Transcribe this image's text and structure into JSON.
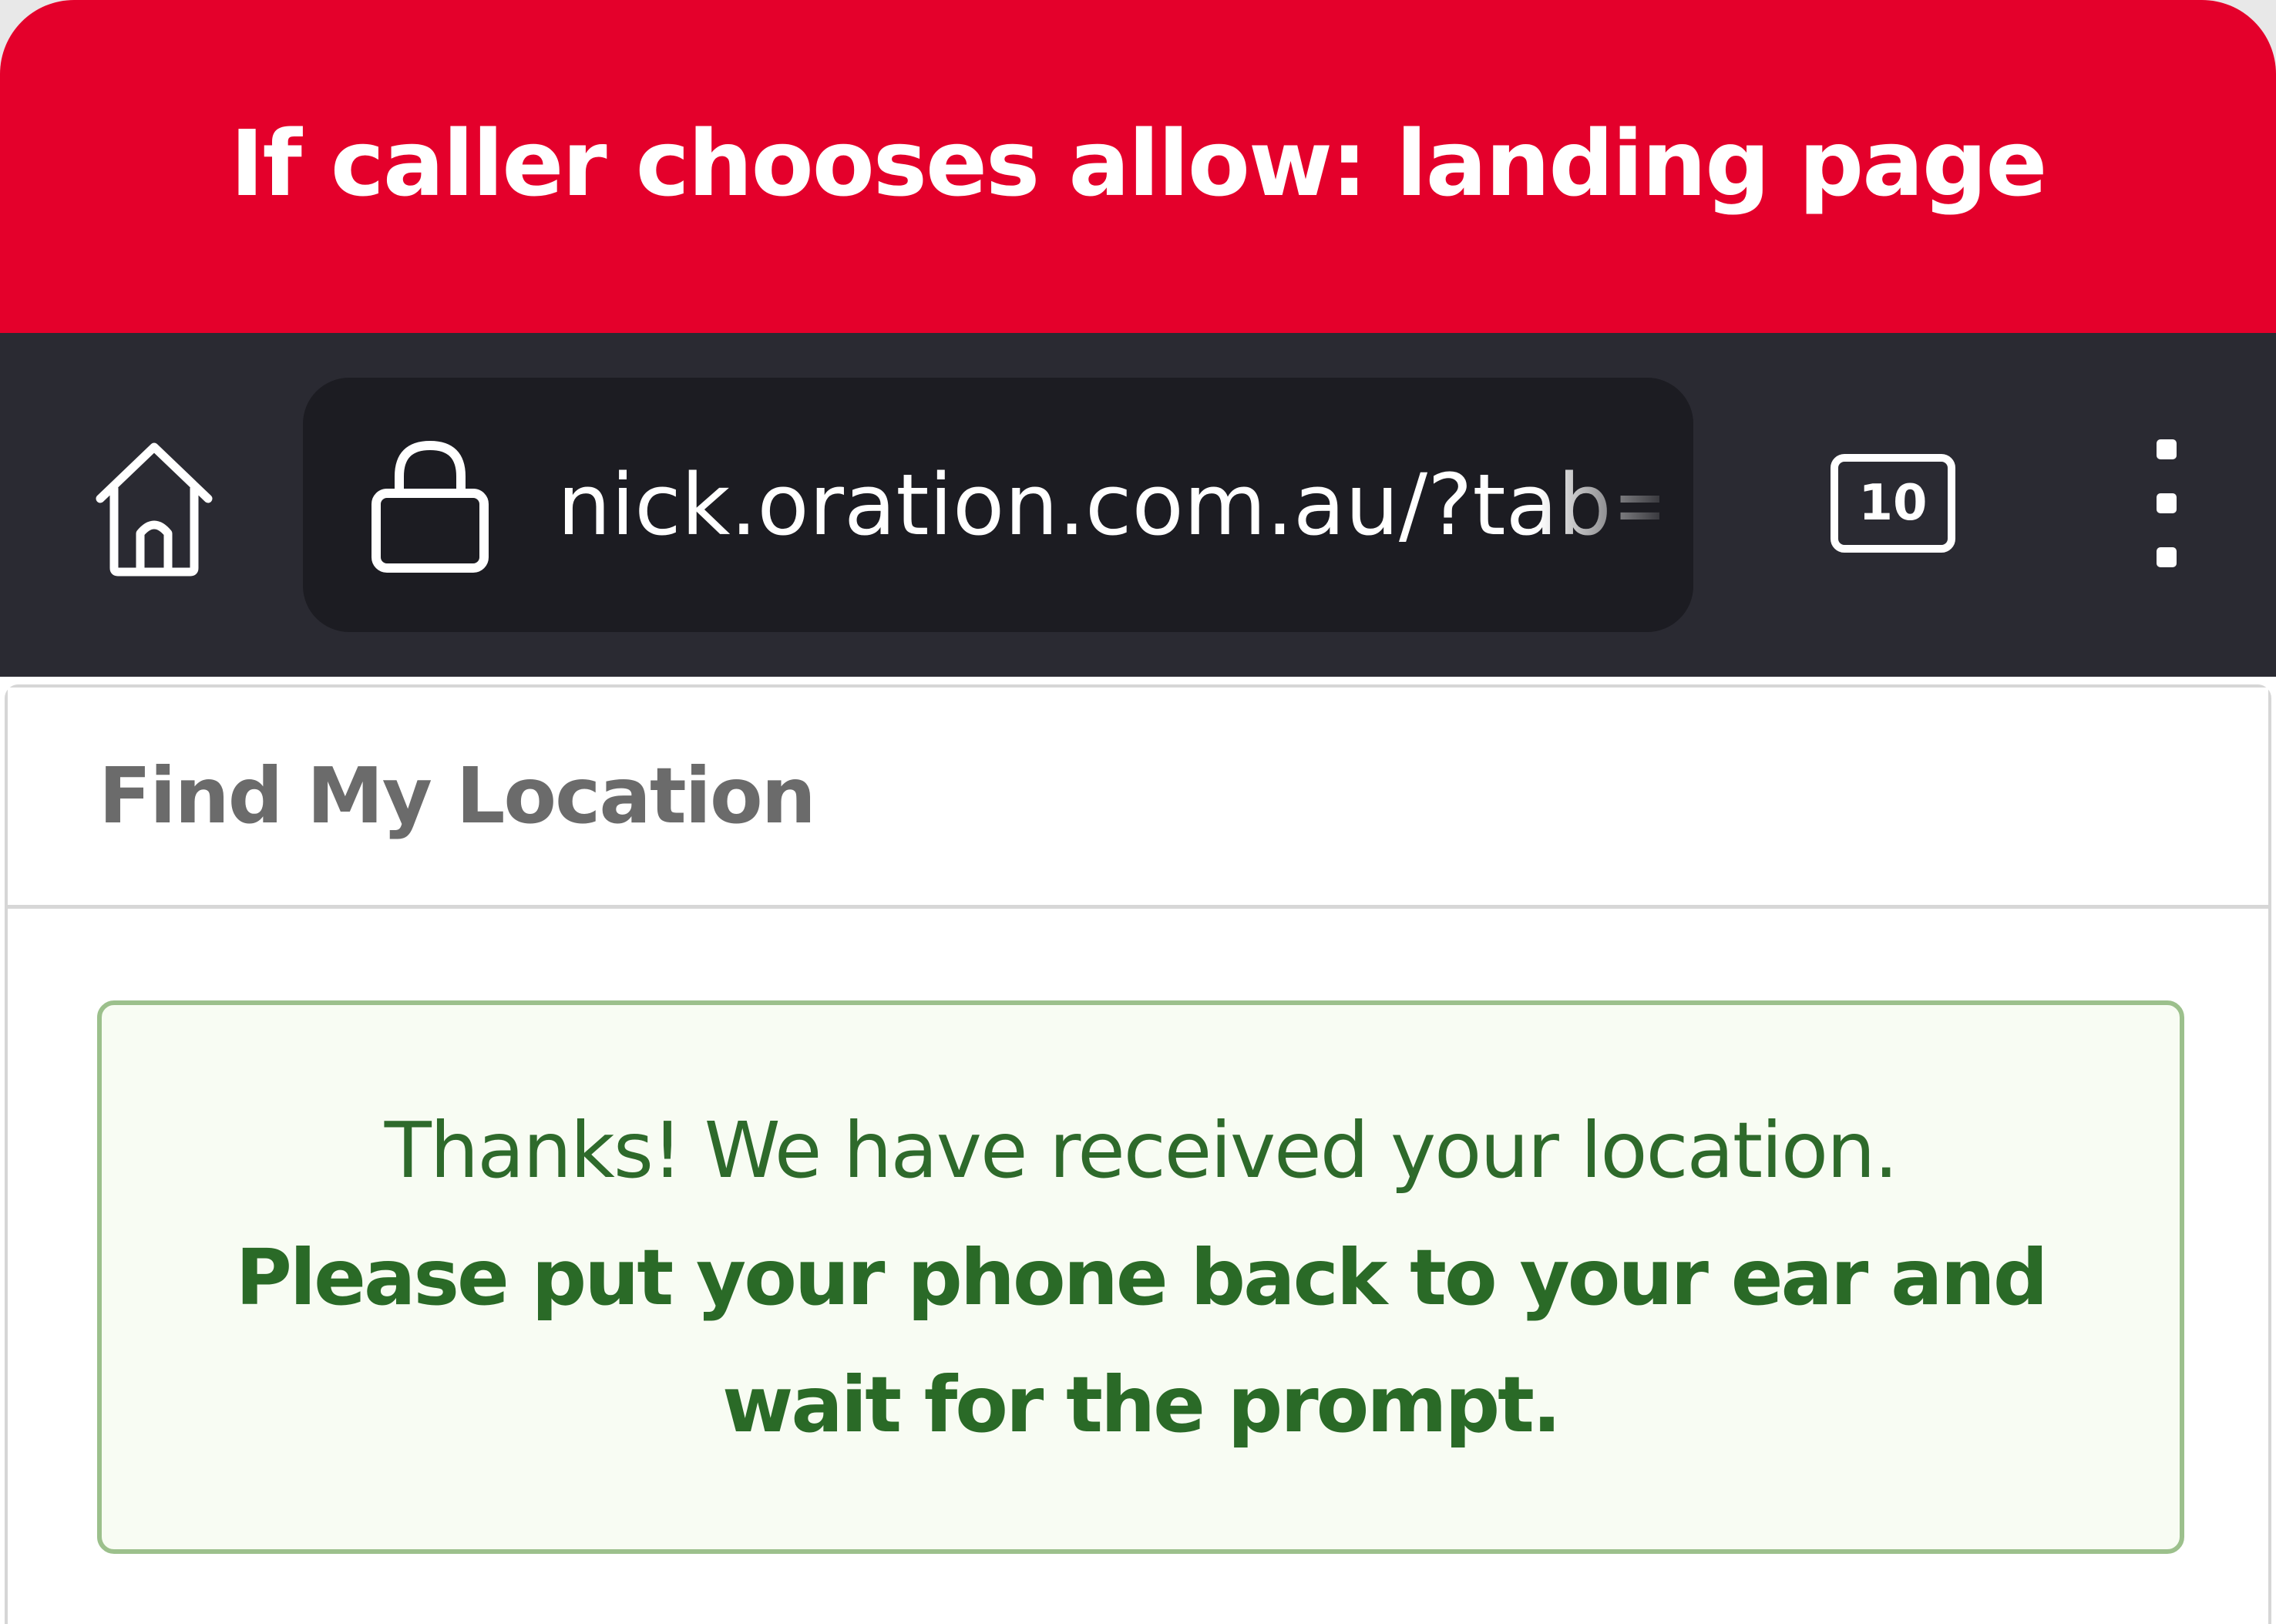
{
  "banner": {
    "title": "If caller chooses allow: landing page",
    "color": "#e4002b"
  },
  "browser": {
    "home_icon": "home-icon",
    "lock_icon": "lock-icon",
    "url": "nick.oration.com.au/?tab=l",
    "tab_count": "10",
    "menu_icon": "more-vert-icon"
  },
  "page": {
    "title": "Find My Location",
    "alert": {
      "line1": "Thanks! We have received your location.",
      "line2": "Please put your phone back to your ear and",
      "line3": "wait for the prompt.",
      "color": "#2a6a27"
    }
  }
}
